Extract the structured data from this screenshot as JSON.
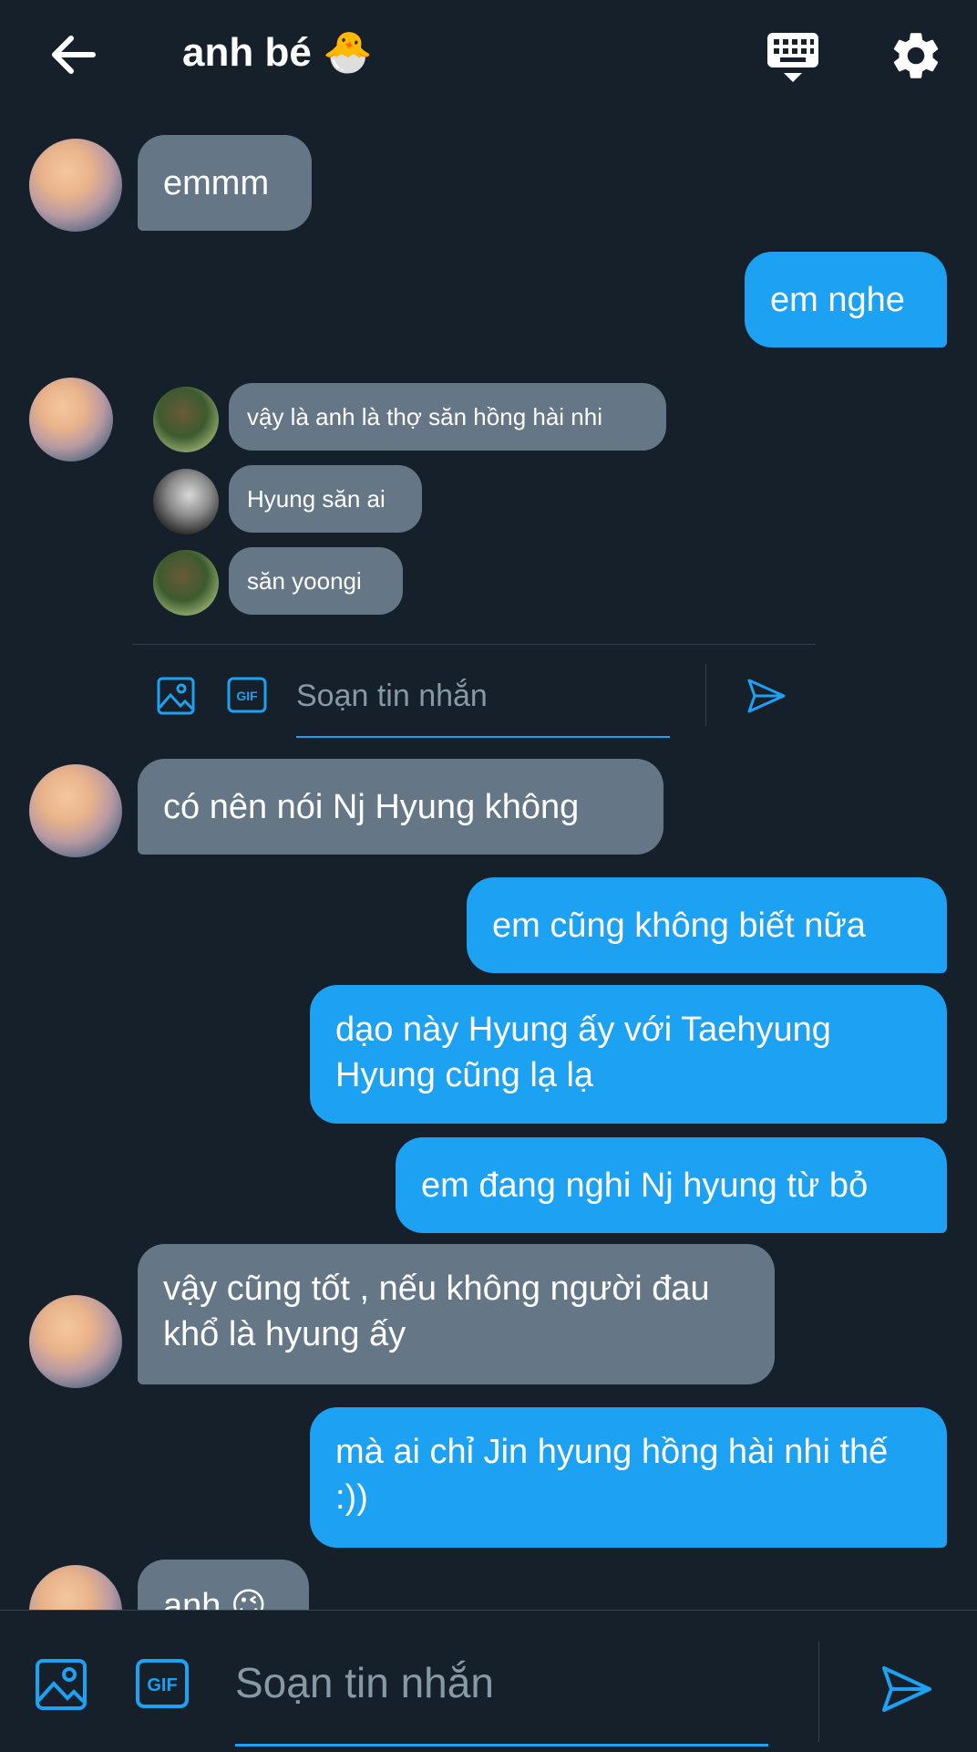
{
  "header": {
    "title": "anh bé 🐣"
  },
  "messages": {
    "m1": "emmm",
    "m2": "em nghe",
    "thread1": "vậy là anh là thợ săn hồng hài nhi",
    "thread2": "Hyung săn ai",
    "thread3": "săn yoongi",
    "m3": "có nên nói Nj Hyung không",
    "m4": "em cũng không biết nữa",
    "m5": "dạo này Hyung ấy với Taehyung Hyung cũng lạ lạ",
    "m6": "em đang nghi Nj hyung từ bỏ",
    "m7": "vậy cũng tốt , nếu không người đau khổ là hyung ấy",
    "m8": "mà ai chỉ Jin hyung hồng hài nhi thế :))",
    "m9": "anh 😉"
  },
  "mini_compose": {
    "placeholder": "Soạn tin nhắn"
  },
  "compose": {
    "placeholder": "Soạn tin nhắn"
  },
  "colors": {
    "background": "#15202b",
    "incoming": "#657786",
    "outgoing": "#1da1f2"
  }
}
